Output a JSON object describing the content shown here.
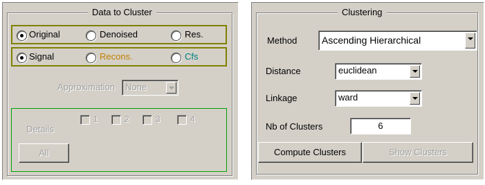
{
  "data_to_cluster": {
    "title": "Data to Cluster",
    "source_options": [
      {
        "label": "Original",
        "selected": true
      },
      {
        "label": "Denoised",
        "selected": false
      },
      {
        "label": "Res.",
        "selected": false
      }
    ],
    "signal_options": [
      {
        "label": "Signal",
        "selected": true,
        "color": "#000000"
      },
      {
        "label": "Recons.",
        "selected": false,
        "color": "#c08000"
      },
      {
        "label": "Cfs",
        "selected": false,
        "color": "#008080"
      }
    ],
    "approximation_label": "Approximation",
    "approximation_value": "None",
    "details_label": "Details",
    "detail_checks": [
      "1",
      "2",
      "3",
      "4"
    ],
    "all_button": "All"
  },
  "clustering": {
    "title": "Clustering",
    "method_label": "Method",
    "method_value": "Ascending Hierarchical",
    "distance_label": "Distance",
    "distance_value": "euclidean",
    "linkage_label": "Linkage",
    "linkage_value": "ward",
    "nb_clusters_label": "Nb of Clusters",
    "nb_clusters_value": "6",
    "compute_button": "Compute Clusters",
    "show_button": "Show Clusters"
  },
  "colors": {
    "panel_bg": "#d4d0c8",
    "group_border_olive": "#808000",
    "group_border_green": "#00a000",
    "recons_text": "#c08000",
    "cfs_text": "#008080"
  }
}
